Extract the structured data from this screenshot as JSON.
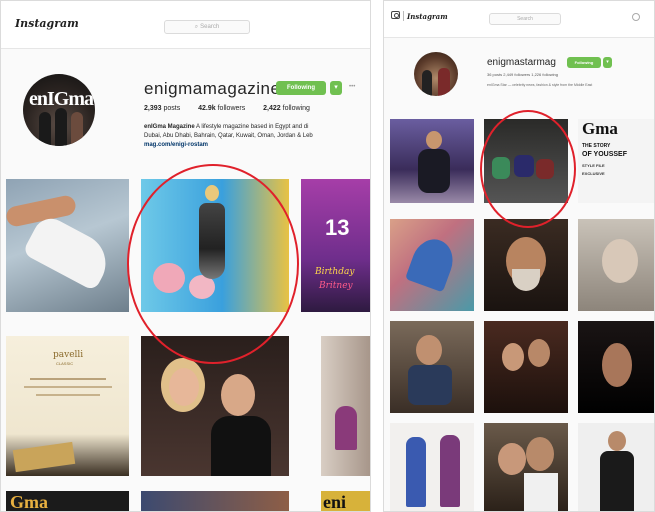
{
  "left": {
    "app_name": "Instagram",
    "search": {
      "placeholder": "Search",
      "icon": "search-icon"
    },
    "profile": {
      "avatar_text": "enIGma",
      "username": "enigmamagazine",
      "follow_button": "Following",
      "follow_dropdown_glyph": "▾",
      "more_glyph": "•••",
      "posts_count": "2,393",
      "posts_label": "posts",
      "followers_count": "42.9k",
      "followers_label": "followers",
      "following_count": "2,422",
      "following_label": "following",
      "bio_name": "enIGma Magazine",
      "bio_line1": " A lifestyle magazine based in Egypt and di",
      "bio_line2": "Dubai, Abu Dhabi, Bahrain, Qatar, Kuwait, Oman, Jordan & Leb",
      "bio_link": "mag.com/enigi-rostam"
    },
    "grid": {
      "invitation_brand": "pavelli",
      "invitation_sub": "CLASSIC",
      "cover_text_1": "Gma",
      "cover_text_2": "eni",
      "party_text": "Birthday",
      "party_name": "Britney",
      "party_number": "13"
    },
    "highlight_color": "#e0212b"
  },
  "right": {
    "app_name": "Instagram",
    "search": {
      "placeholder": "Search"
    },
    "profile": {
      "username": "enigmastarmag",
      "follow_button": "Following",
      "follow_dropdown_glyph": "▾",
      "stats_line": "36 posts   2,449 followers   1,226 following",
      "bio_line": "enIGma Star — celebrity news, fashion & style from the Middle East"
    },
    "grid": {
      "cover_brand": "Gma",
      "cover_lines": [
        "THE STORY",
        "OF YOUSSEF",
        "STYLE FILE",
        "EXCLUSIVE"
      ]
    }
  }
}
